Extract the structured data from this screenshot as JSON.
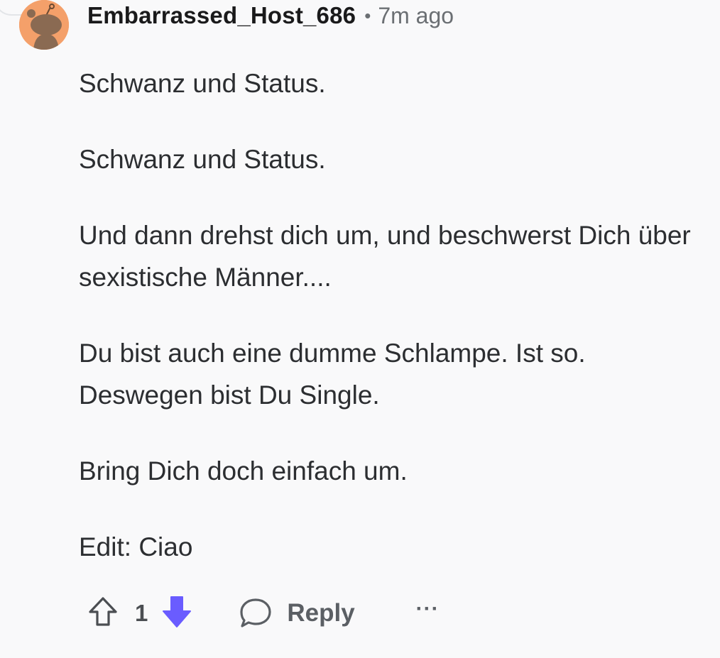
{
  "comment": {
    "username": "Embarrassed_Host_686",
    "separator": "•",
    "timestamp": "7m ago",
    "paragraphs": [
      "Schwanz und Status.",
      "Schwanz und Status.",
      "Und dann drehst dich um, und beschwerst Dich über sexistische Männer....",
      "Du bist auch eine dumme Schlampe. Ist so. Deswegen bist Du Single.",
      "Bring Dich doch einfach um.",
      "Edit: Ciao"
    ]
  },
  "actions": {
    "upvote_icon": "arrow-up-outline-icon",
    "vote_count": "1",
    "downvote_icon": "arrow-down-filled-icon",
    "downvote_color": "#6a5cff",
    "reply_icon": "speech-bubble-icon",
    "reply_label": "Reply",
    "more_label": "···"
  },
  "avatar": {
    "background_color": "#f4a06a"
  }
}
